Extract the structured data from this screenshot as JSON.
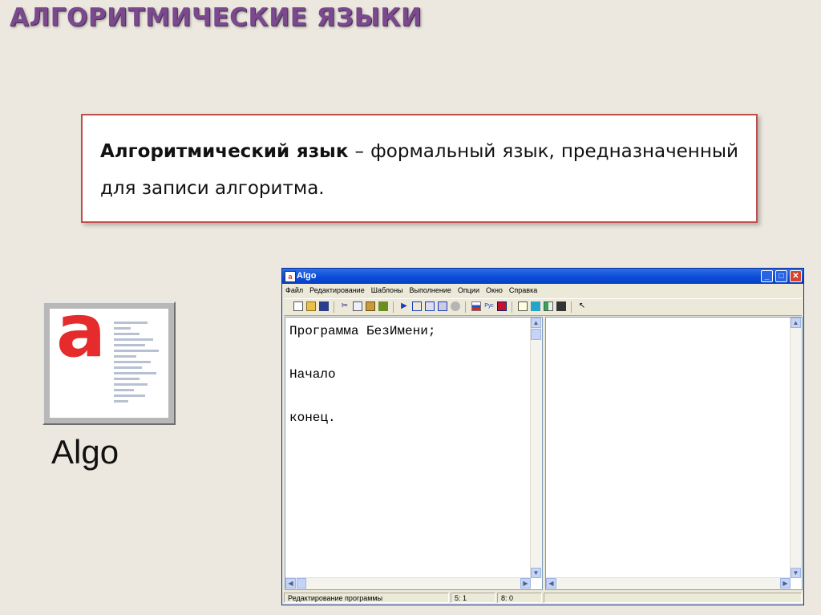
{
  "slide": {
    "title": "АЛГОРИТМИЧЕСКИЕ ЯЗЫКИ",
    "definition_term": "Алгоритмический язык",
    "definition_text": " – формальный язык, предназначенный для записи алгоритма.",
    "logo_letter": "a",
    "app_name": "Algo"
  },
  "window": {
    "title": "Algo",
    "menu": [
      "Файл",
      "Редактирование",
      "Шаблоны",
      "Выполнение",
      "Опции",
      "Окно",
      "Справка"
    ],
    "toolbar_icons": [
      "new-file-icon",
      "open-folder-icon",
      "save-icon",
      "cut-icon",
      "copy-icon",
      "paste-icon",
      "template-icon",
      "run-icon",
      "step-icon",
      "step-into-icon",
      "trace-icon",
      "stop-icon",
      "russian-flag-icon",
      "rus-text-icon",
      "english-flag-icon",
      "window-icon",
      "window-2-icon",
      "window-3-icon",
      "window-4-icon",
      "help-pointer-icon"
    ],
    "lang_label": "Рус",
    "code_lines": [
      "Программа БезИмени;",
      "",
      "Начало",
      "",
      "конец."
    ],
    "status": {
      "mode": "Редактирование программы",
      "pos1": "5: 1",
      "pos2": "8: 0"
    }
  }
}
